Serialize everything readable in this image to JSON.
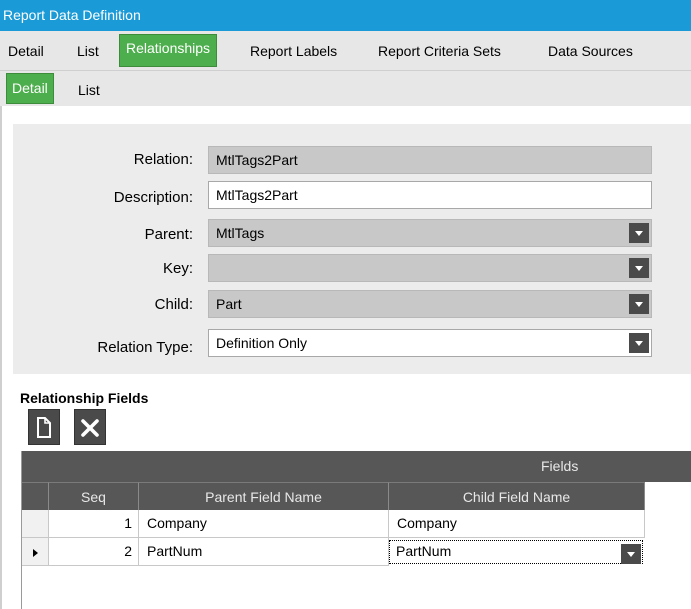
{
  "window": {
    "title": "Report Data Definition"
  },
  "tabs_main": [
    {
      "label": "Detail"
    },
    {
      "label": "List"
    },
    {
      "label": "Relationships"
    },
    {
      "label": "Report Labels"
    },
    {
      "label": "Report Criteria Sets"
    },
    {
      "label": "Data Sources"
    }
  ],
  "tabs_sub": [
    {
      "label": "Detail"
    },
    {
      "label": "List"
    }
  ],
  "form": {
    "relation": {
      "label": "Relation:",
      "value": "MtlTags2Part"
    },
    "description": {
      "label": "Description:",
      "value": "MtlTags2Part"
    },
    "parent": {
      "label": "Parent:",
      "value": "MtlTags"
    },
    "key": {
      "label": "Key:",
      "value": ""
    },
    "child": {
      "label": "Child:",
      "value": "Part"
    },
    "relation_type": {
      "label": "Relation Type:",
      "value": "Definition Only"
    }
  },
  "relationship_fields": {
    "title": "Relationship Fields",
    "toolbar": {
      "new_icon": "new-document-icon",
      "delete_icon": "delete-x-icon"
    },
    "band_label": "Fields",
    "columns": {
      "seq": "Seq",
      "parent": "Parent Field Name",
      "child": "Child Field Name"
    },
    "rows": [
      {
        "seq": "1",
        "parent": "Company",
        "child": "Company"
      },
      {
        "seq": "2",
        "parent": "PartNum",
        "child": "PartNum"
      }
    ]
  },
  "colors": {
    "accent": "#1a9ad6",
    "tab_active": "#4cae4c",
    "grid_header": "#575757"
  }
}
